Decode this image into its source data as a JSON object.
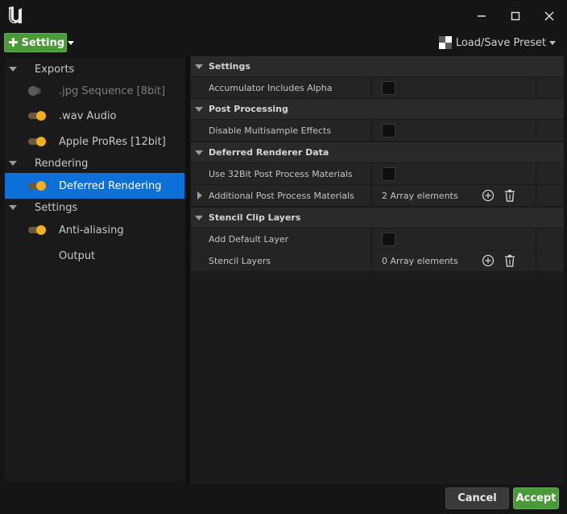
{
  "window": {
    "logo": "unreal-engine-logo",
    "controls": [
      "minimize",
      "maximize",
      "close"
    ]
  },
  "toolbar": {
    "add_setting_label": "Setting",
    "preset_label": "Load/Save Preset"
  },
  "tree": {
    "categories": [
      {
        "label": "Exports"
      },
      {
        "label": "Rendering"
      },
      {
        "label": "Settings"
      }
    ],
    "items": [
      {
        "label": ".jpg Sequence [8bit]",
        "enabled": false
      },
      {
        "label": ".wav Audio",
        "enabled": true
      },
      {
        "label": "Apple ProRes [12bit]",
        "enabled": true
      },
      {
        "label": "Deferred Rendering",
        "enabled": true,
        "selected": true
      },
      {
        "label": "Anti-aliasing",
        "enabled": true
      },
      {
        "label": "Output"
      }
    ]
  },
  "details": {
    "sections": [
      {
        "title": "Settings"
      },
      {
        "title": "Post Processing"
      },
      {
        "title": "Deferred Renderer Data"
      },
      {
        "title": "Stencil Clip Layers"
      }
    ],
    "properties": [
      {
        "name": "Accumulator Includes Alpha",
        "type": "checkbox",
        "checked": false
      },
      {
        "name": "Disable Multisample Effects",
        "type": "checkbox",
        "checked": false
      },
      {
        "name": "Use 32Bit Post Process Materials",
        "type": "checkbox",
        "checked": false
      },
      {
        "name": "Additional Post Process Materials",
        "type": "array",
        "value": "2 Array elements"
      },
      {
        "name": "Add Default Layer",
        "type": "checkbox",
        "checked": false
      },
      {
        "name": "Stencil Layers",
        "type": "array",
        "value": "0 Array elements"
      }
    ]
  },
  "footer": {
    "cancel_label": "Cancel",
    "accept_label": "Accept"
  },
  "colors": {
    "accent_green": "#4a9a3a",
    "selection_blue": "#0d6fd8",
    "toggle_on": "#f0b020"
  }
}
